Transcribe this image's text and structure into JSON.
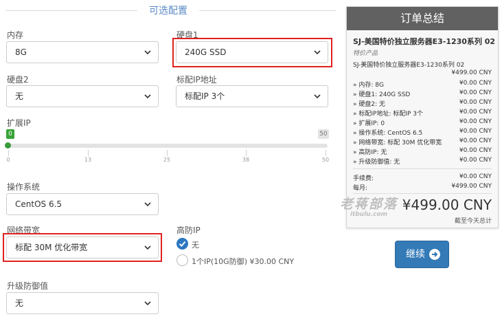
{
  "section_title": "可选配置",
  "fields": {
    "memory": {
      "label": "内存",
      "value": "8G"
    },
    "disk1": {
      "label": "硬盘1",
      "value": "240G SSD"
    },
    "disk2": {
      "label": "硬盘2",
      "value": "无"
    },
    "ip": {
      "label": "标配IP地址",
      "value": "标配IP 3个"
    },
    "extip": {
      "label": "扩展IP",
      "min_tag": "0",
      "max_tag": "50",
      "value": 0,
      "max": 50,
      "ticks": [
        "0",
        "13",
        "25",
        "38",
        "50"
      ]
    },
    "os": {
      "label": "操作系统",
      "value": "CentOS 6.5"
    },
    "bandwidth": {
      "label": "网络带宽",
      "value": "标配 30M 优化带宽"
    },
    "ddos": {
      "label": "高防IP",
      "option_none": "无",
      "option_one": "1个IP(10G防御) ¥30.00 CNY"
    },
    "defense": {
      "label": "升级防御值",
      "value": "无"
    }
  },
  "summary": {
    "title": "订单总结",
    "product_name": "SJ-美国特价独立服务器E3-1230系列 02",
    "product_group": "特价产品",
    "product_full": "SJ-美国特价独立服务器E3-1230系列 02",
    "product_price": "¥499.00 CNY",
    "config_lines": [
      {
        "k": "» 内存: 8G",
        "v": "¥0.00 CNY"
      },
      {
        "k": "» 硬盘1: 240G SSD",
        "v": "¥0.00 CNY"
      },
      {
        "k": "» 硬盘2: 无",
        "v": "¥0.00 CNY"
      },
      {
        "k": "» 标配IP地址: 标配IP 3个",
        "v": "¥0.00 CNY"
      },
      {
        "k": "» 扩展IP: 0",
        "v": "¥0.00 CNY"
      },
      {
        "k": "» 操作系统: CentOS 6.5",
        "v": "¥0.00 CNY"
      },
      {
        "k": "» 网络带宽: 标配 30M 优化带宽",
        "v": "¥0.00 CNY"
      },
      {
        "k": "» 高防IP: 无",
        "v": "¥0.00 CNY"
      },
      {
        "k": "» 升级防御值: 无",
        "v": "¥0.00 CNY"
      }
    ],
    "setup_fee_label": "手续费:",
    "setup_fee_value": "¥0.00 CNY",
    "monthly_label": "每月:",
    "monthly_value": "¥499.00 CNY",
    "total": "¥499.00 CNY",
    "total_note": "截至今天总计"
  },
  "watermark": {
    "line1": "老蒋部落",
    "line2": "itbulu.com"
  },
  "continue_label": "继续",
  "colors": {
    "accent": "#337ab7",
    "highlight": "#e02020",
    "slider": "#3a9a3a",
    "header": "#616161"
  }
}
